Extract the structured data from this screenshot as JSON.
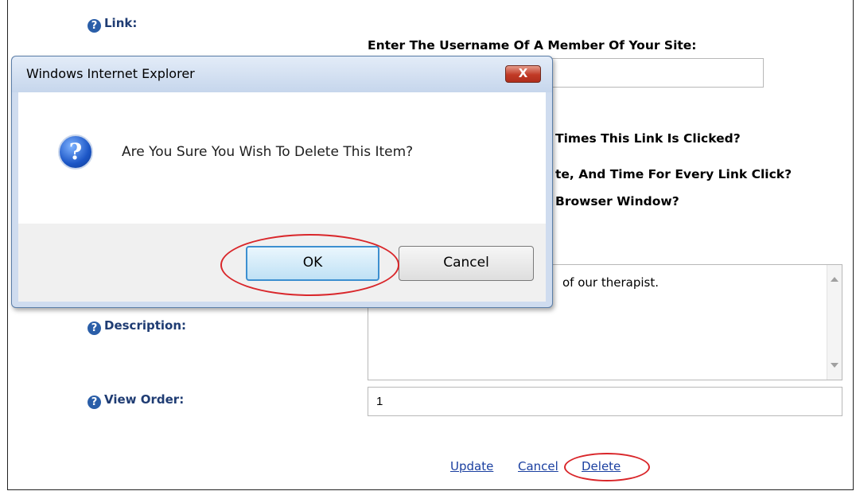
{
  "form": {
    "link_label": "Link:",
    "username_prompt": "Enter The Username Of A Member Of Your Site:",
    "username_value": "",
    "q_times_clicked": "Times This Link Is Clicked?",
    "q_date_time": "te, And Time For Every Link Click?",
    "q_browser_window": "Browser Window?",
    "description_label": "Description:",
    "description_value": "of our therapist.",
    "view_order_label": "View Order:",
    "view_order_value": "1",
    "help_glyph": "?"
  },
  "actions": {
    "update": "Update",
    "cancel": "Cancel",
    "delete": "Delete"
  },
  "dialog": {
    "title": "Windows Internet Explorer",
    "close_glyph": "X",
    "question_glyph": "?",
    "message": "Are You Sure You Wish To Delete This Item?",
    "ok_label": "OK",
    "cancel_label": "Cancel"
  },
  "colors": {
    "highlight_circle": "#d9262a",
    "link": "#1a3fa0",
    "label": "#1f3c73"
  }
}
